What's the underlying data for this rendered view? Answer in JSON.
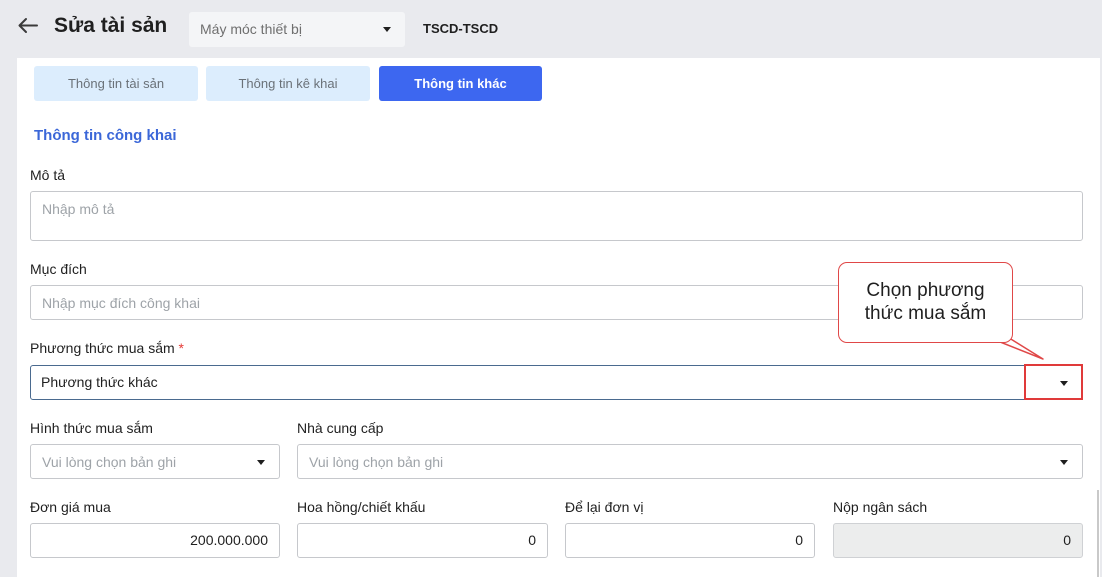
{
  "header": {
    "title": "Sửa tài sản",
    "type_select_value": "Máy móc thiết bị",
    "asset_code": "TSCD-TSCD"
  },
  "tabs": [
    {
      "label": "Thông tin tài sản",
      "active": false
    },
    {
      "label": "Thông tin kê khai",
      "active": false
    },
    {
      "label": "Thông tin khác",
      "active": true
    }
  ],
  "section": {
    "title": "Thông tin công khai"
  },
  "form": {
    "description": {
      "label": "Mô tả",
      "placeholder": "Nhập mô tả"
    },
    "purpose": {
      "label": "Mục đích",
      "placeholder": "Nhập mục đích công khai"
    },
    "purchase_method": {
      "label": "Phương thức mua sắm",
      "required_mark": "*",
      "value": "Phương thức khác"
    },
    "purchase_form": {
      "label": "Hình thức mua sắm",
      "placeholder": "Vui lòng chọn bản ghi"
    },
    "supplier": {
      "label": "Nhà cung cấp",
      "placeholder": "Vui lòng chọn bản ghi"
    },
    "unit_price": {
      "label": "Đơn giá mua",
      "value": "200.000.000"
    },
    "commission": {
      "label": "Hoa hồng/chiết khấu",
      "value": "0"
    },
    "retained": {
      "label": "Để lại đơn vị",
      "value": "0"
    },
    "budget": {
      "label": "Nộp ngân sách",
      "value": "0"
    }
  },
  "callout": {
    "line1": "Chọn phương",
    "line2": "thức mua sắm"
  },
  "colors": {
    "accent": "#3d67f0",
    "section_title": "#3b67d8",
    "highlight": "#e03a3a",
    "tab_inactive": "#dcedfd"
  },
  "icons": {
    "back": "arrow-left-icon",
    "dropdown": "caret-down-icon"
  }
}
